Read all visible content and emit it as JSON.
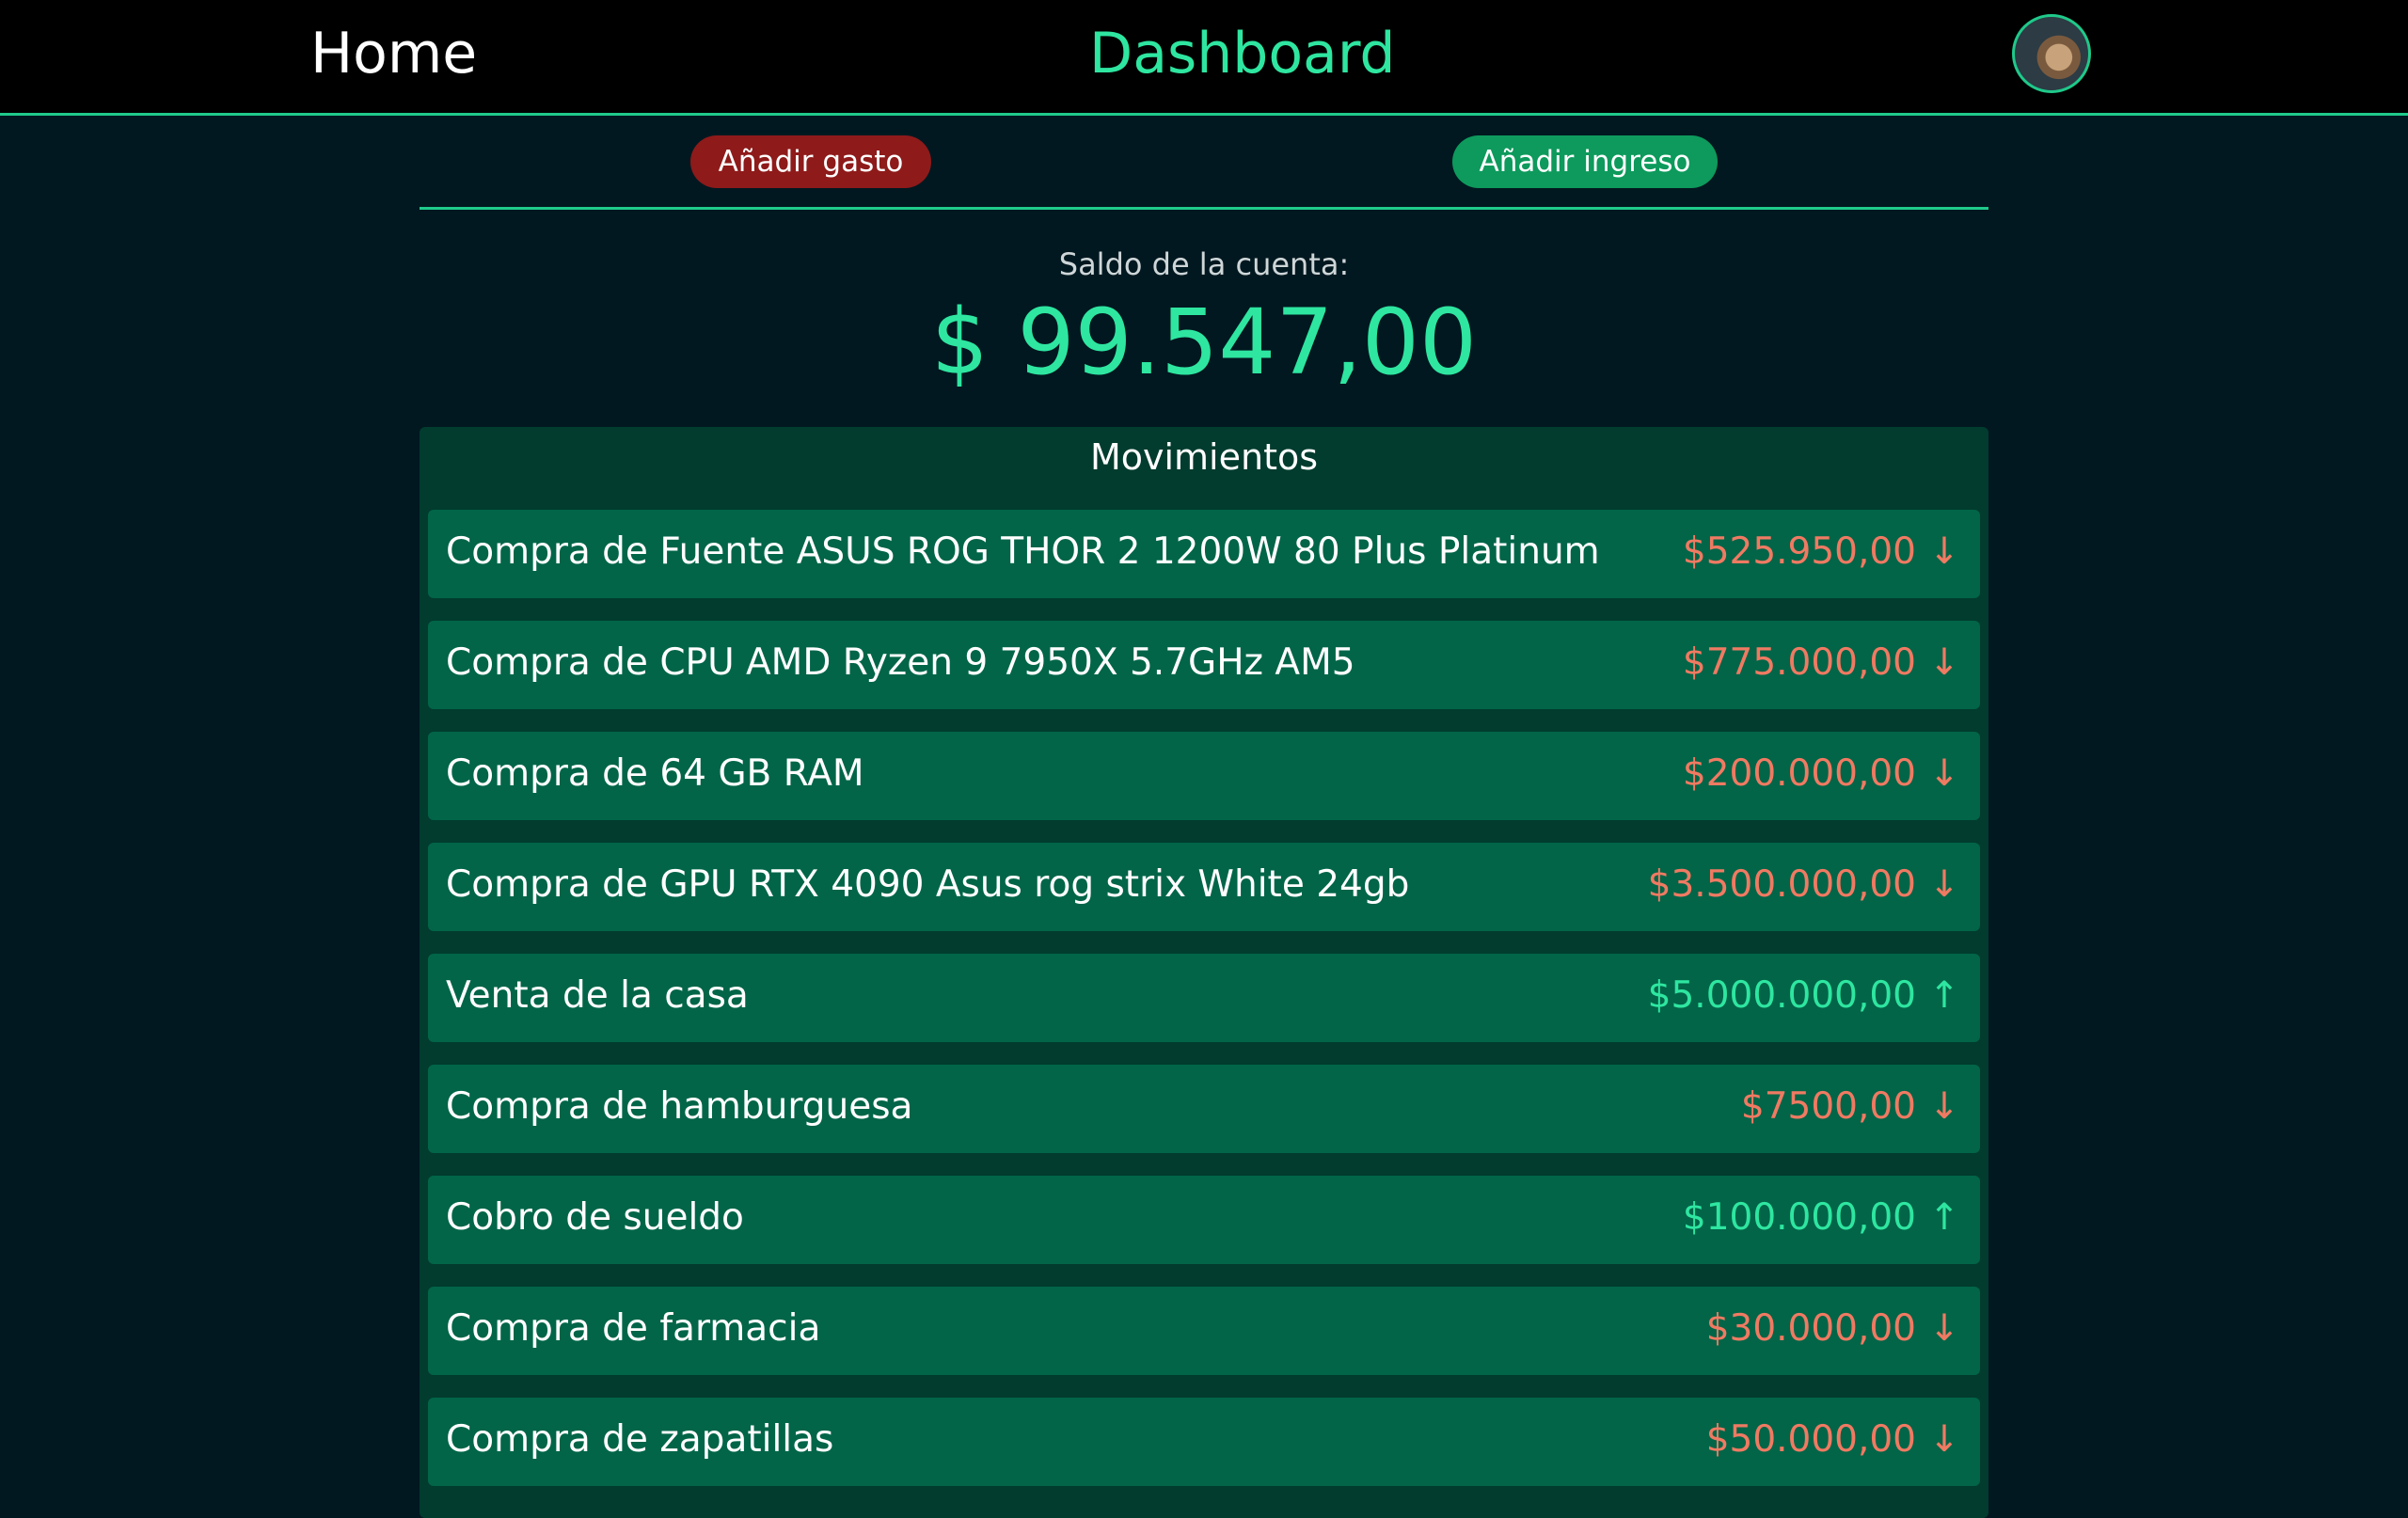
{
  "header": {
    "home_label": "Home",
    "title": "Dashboard",
    "avatar_icon": "user-avatar-icon"
  },
  "actions": {
    "add_expense_label": "Añadir gasto",
    "add_income_label": "Añadir ingreso"
  },
  "balance": {
    "label": "Saldo de la cuenta:",
    "value": "$ 99.547,00"
  },
  "movements": {
    "title": "Movimientos",
    "items": [
      {
        "description": "Compra de Fuente ASUS ROG THOR 2 1200W 80 Plus Platinum",
        "amount": "$525.950,00",
        "direction": "out",
        "arrow": "↓"
      },
      {
        "description": "Compra de CPU AMD Ryzen 9 7950X 5.7GHz AM5",
        "amount": "$775.000,00",
        "direction": "out",
        "arrow": "↓"
      },
      {
        "description": "Compra de 64 GB RAM",
        "amount": "$200.000,00",
        "direction": "out",
        "arrow": "↓"
      },
      {
        "description": "Compra de GPU RTX 4090 Asus rog strix White 24gb",
        "amount": "$3.500.000,00",
        "direction": "out",
        "arrow": "↓"
      },
      {
        "description": "Venta de la casa",
        "amount": "$5.000.000,00",
        "direction": "in",
        "arrow": "↑"
      },
      {
        "description": "Compra de hamburguesa",
        "amount": "$7500,00",
        "direction": "out",
        "arrow": "↓"
      },
      {
        "description": "Cobro de sueldo",
        "amount": "$100.000,00",
        "direction": "in",
        "arrow": "↑"
      },
      {
        "description": "Compra de farmacia",
        "amount": "$30.000,00",
        "direction": "out",
        "arrow": "↓"
      },
      {
        "description": "Compra de zapatillas",
        "amount": "$50.000,00",
        "direction": "out",
        "arrow": "↓"
      }
    ]
  },
  "colors": {
    "accent": "#2ee6a0",
    "expense": "#f07a62",
    "income": "#2ee6a0",
    "background": "#011820"
  }
}
